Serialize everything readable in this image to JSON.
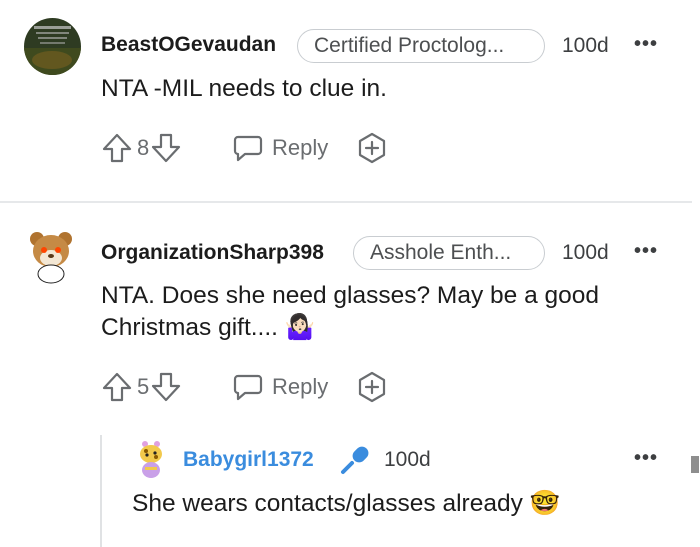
{
  "colors": {
    "text": "#1c1c1c",
    "muted": "#6a6d70",
    "flair_border": "#c9cdd1",
    "username_blue": "#3a8cde",
    "divider": "#e6e8ea"
  },
  "comments": [
    {
      "username": "BeastOGevaudan",
      "flair": "Certified Proctolog...",
      "age": "100d",
      "body": "NTA -MIL needs to clue in.",
      "votes": "8",
      "reply_label": "Reply",
      "avatar_icon": "dark-forest-avatar-icon"
    },
    {
      "username": "OrganizationSharp398",
      "flair": "Asshole Enth...",
      "age": "100d",
      "body": "NTA. Does she need glasses? May be a good Christmas gift....",
      "body_emoji": "🤷🏻‍♀️",
      "votes": "5",
      "reply_label": "Reply",
      "avatar_icon": "snoo-bear-avatar-icon"
    },
    {
      "username": "Babygirl1372",
      "user_icon": "microphone-icon",
      "age": "100d",
      "body": "She wears contacts/glasses already",
      "body_emoji": "🤓",
      "avatar_icon": "snoo-giraffe-avatar-icon"
    }
  ],
  "more_label": "•••"
}
